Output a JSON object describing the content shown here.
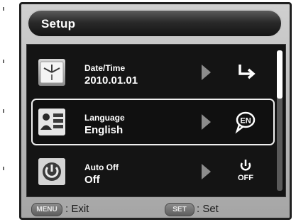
{
  "title": "Setup",
  "items": [
    {
      "label": "Date/Time",
      "value": "2010.01.01",
      "icon": "clock-icon",
      "state_icon": "enter-arrow-icon",
      "selected": false
    },
    {
      "label": "Language",
      "value": "English",
      "icon": "language-icon",
      "state_icon": "en-speech-bubble-icon",
      "selected": true
    },
    {
      "label": "Auto Off",
      "value": "Off",
      "icon": "power-icon",
      "state_icon": "power-off-icon",
      "state_text": "OFF",
      "selected": false
    }
  ],
  "footer": {
    "menu_key": "MENU",
    "menu_action": ": Exit",
    "set_key": "SET",
    "set_action": ": Set"
  },
  "language_badge": "EN",
  "colors": {
    "panel": "#141414",
    "bezel": "#a5a5a5",
    "text": "#ffffff",
    "arrow": "#8c8c8c"
  }
}
